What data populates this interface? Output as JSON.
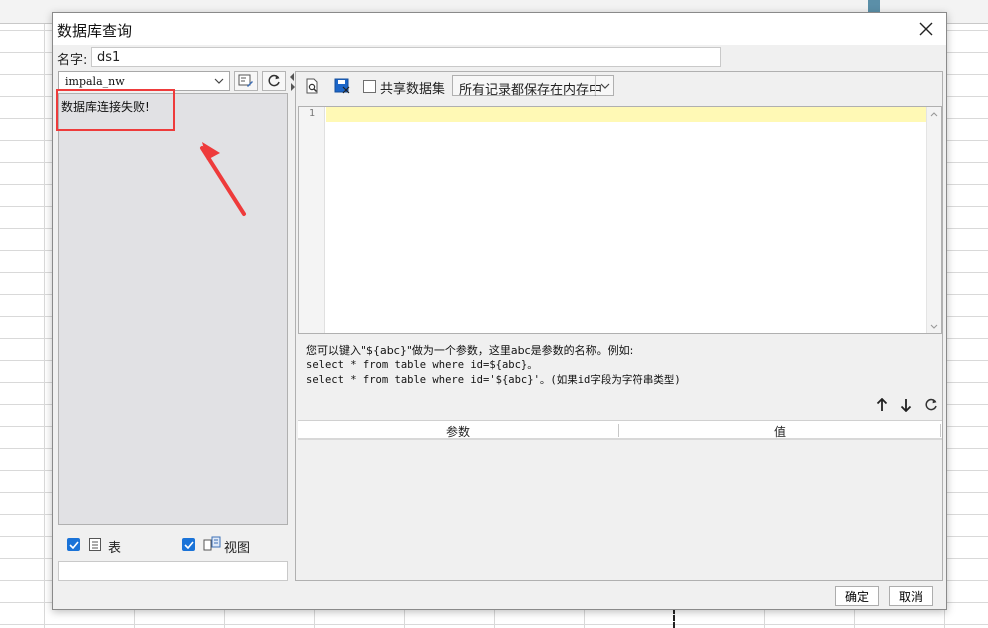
{
  "dialog": {
    "title": "数据库查询",
    "name_label": "名字:",
    "name_value": "ds1"
  },
  "left": {
    "connection": "impala_nw",
    "error_message": "数据库连接失败!",
    "filters": [
      {
        "label": "表",
        "checked": true
      },
      {
        "label": "视图",
        "checked": true
      }
    ]
  },
  "right": {
    "share_label": "共享数据集",
    "share_checked": false,
    "memory_option": "所有记录都保存在内存中",
    "editor": {
      "line_numbers": [
        "1"
      ],
      "content": ""
    },
    "hint": {
      "line1": "您可以键入\"${abc}\"做为一个参数，这里abc是参数的名称。例如:",
      "line2": "select * from table where id=${abc}。",
      "line3": "select * from table where id='${abc}'。(如果id字段为字符串类型)"
    },
    "param_table": {
      "columns": [
        "参数",
        "值"
      ]
    }
  },
  "footer": {
    "ok": "确定",
    "cancel": "取消"
  },
  "colors": {
    "checkbox_blue": "#1a73d8",
    "annotation_red": "#ee3b3b",
    "editor_line_highlight": "#fff9b5"
  },
  "icons": {
    "close": "close-icon",
    "dropdown": "chevron-down-icon",
    "edit_connection": "edit-connection-icon",
    "refresh": "refresh-icon",
    "preview": "preview-icon",
    "save": "save-icon",
    "move_up": "arrow-up-icon",
    "move_down": "arrow-down-icon",
    "table": "table-icon",
    "view": "view-icon"
  }
}
